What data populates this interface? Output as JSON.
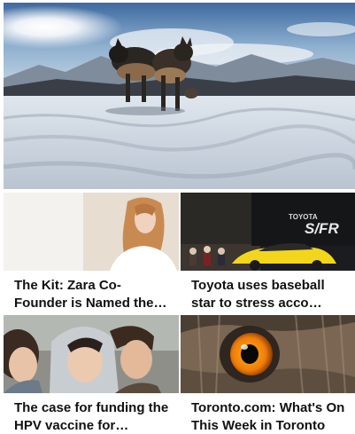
{
  "hero": {
    "icon": "sled-dogs-in-snow-photo"
  },
  "cards": [
    {
      "headline": "The Kit: Zara Co-Founder is Named the Richest Woman Alive",
      "thumb_icon": "fashion-model-photo"
    },
    {
      "headline": "Toyota uses baseball star to stress acco…",
      "thumb_icon": "yellow-sports-car-photo",
      "thumb_text": "TOYOTA",
      "thumb_badge": "S/FR"
    },
    {
      "headline": "The case for funding the HPV vaccine for…",
      "thumb_icon": "teenagers-photo"
    },
    {
      "headline": "Toronto.com: What's On This Week in Toronto",
      "thumb_icon": "owl-eye-photo"
    }
  ]
}
